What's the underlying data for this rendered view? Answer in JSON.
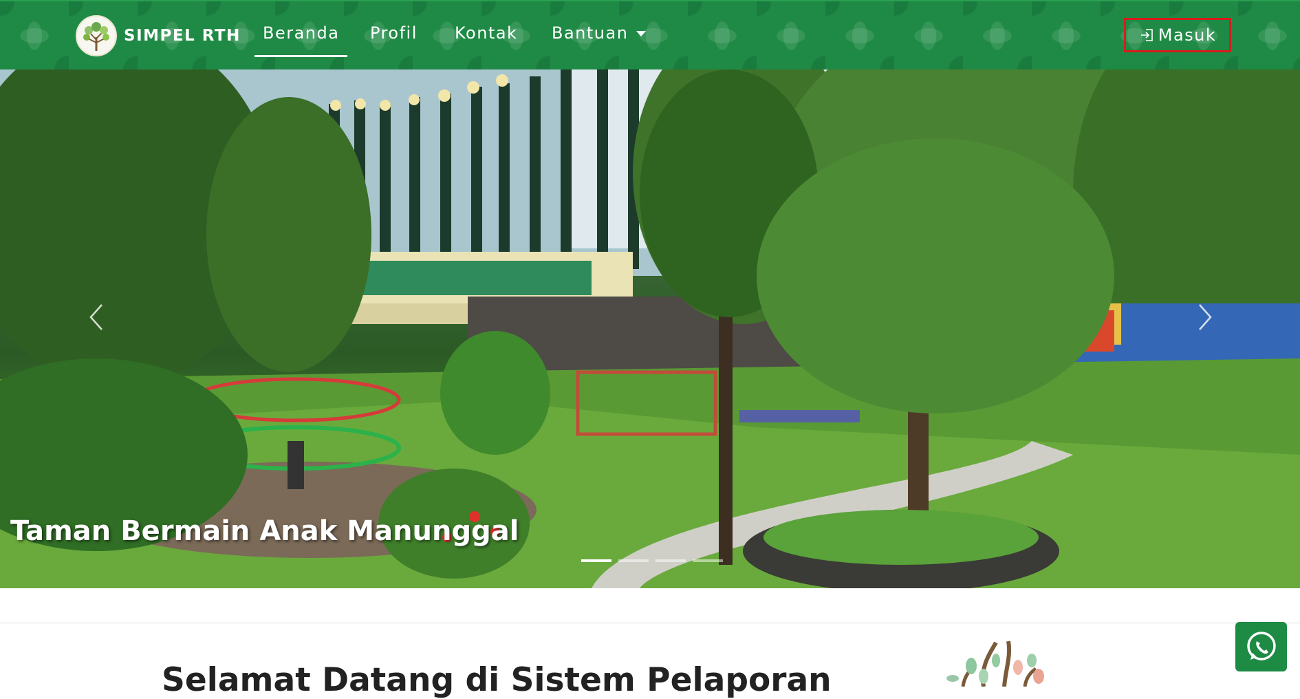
{
  "navbar": {
    "brand": "SIMPEL RTH",
    "menu": [
      {
        "label": "Beranda",
        "active": true
      },
      {
        "label": "Profil",
        "active": false
      },
      {
        "label": "Kontak",
        "active": false
      },
      {
        "label": "Bantuan",
        "active": false,
        "dropdown": true
      }
    ],
    "login_label": "Masuk",
    "colors": {
      "bar": "#1f8a45",
      "login_border": "#d71c1c"
    }
  },
  "carousel": {
    "caption": "Taman Bermain Anak Manunggal",
    "slide_count": 4,
    "active_slide": 1,
    "icons": [
      "chevron-left-icon",
      "chevron-right-icon"
    ]
  },
  "content": {
    "welcome_title": "Selamat Datang di Sistem Pelaporan"
  },
  "whatsapp": {
    "icon": "whatsapp-icon",
    "color": "#1e8b45"
  }
}
